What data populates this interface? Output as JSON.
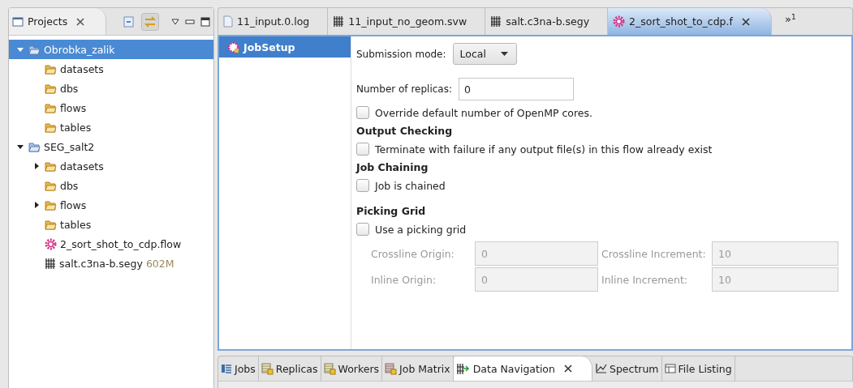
{
  "projects_view": {
    "title": "Projects",
    "tree": [
      {
        "label": "Obrobka_zalik",
        "kind": "project",
        "expanded": true,
        "selected": true,
        "children": [
          {
            "label": "datasets",
            "kind": "folder",
            "selected": false
          },
          {
            "label": "dbs",
            "kind": "folder",
            "selected": false
          },
          {
            "label": "flows",
            "kind": "folder",
            "selected": false
          },
          {
            "label": "tables",
            "kind": "folder",
            "selected": false
          }
        ]
      },
      {
        "label": "SEG_salt2",
        "kind": "project",
        "expanded": true,
        "selected": false,
        "children": [
          {
            "label": "datasets",
            "kind": "folder",
            "expanded": false,
            "selected": false
          },
          {
            "label": "dbs",
            "kind": "folder",
            "selected": false
          },
          {
            "label": "flows",
            "kind": "folder",
            "expanded": false,
            "selected": false
          },
          {
            "label": "tables",
            "kind": "folder",
            "selected": false
          },
          {
            "label": "2_sort_shot_to_cdp.flow",
            "kind": "flow",
            "selected": false
          },
          {
            "label": "salt.c3na-b.segy",
            "kind": "segy",
            "size": "602M",
            "selected": false
          }
        ]
      }
    ]
  },
  "editor_tabs": [
    {
      "label": "11_input.0.log",
      "kind": "log",
      "selected": false
    },
    {
      "label": "11_input_no_geom.svw",
      "kind": "segy",
      "selected": false
    },
    {
      "label": "salt.c3na-b.segy",
      "kind": "segy",
      "selected": false
    },
    {
      "label": "2_sort_shot_to_cdp.f",
      "kind": "flow",
      "selected": true
    }
  ],
  "overflow": {
    "glyph": "»",
    "count": "1"
  },
  "sections": [
    {
      "label": "JobSetup",
      "selected": true
    }
  ],
  "form_groups": [
    [
      {
        "kind": "select",
        "label": "Submission mode:",
        "value": "Local"
      }
    ],
    [
      {
        "kind": "text",
        "label": "Number of replicas:",
        "value": "0"
      },
      {
        "kind": "checkbox",
        "label": "Override default number of OpenMP cores.",
        "checked": false
      },
      {
        "kind": "heading",
        "label": "Output Checking"
      },
      {
        "kind": "checkbox",
        "label": "Terminate with failure if any output file(s) in this flow already exist",
        "checked": false
      },
      {
        "kind": "heading",
        "label": "Job Chaining"
      },
      {
        "kind": "checkbox",
        "label": "Job is chained",
        "checked": false
      }
    ],
    [
      {
        "kind": "heading",
        "label": "Picking Grid"
      },
      {
        "kind": "checkbox",
        "label": "Use a picking grid",
        "checked": false
      },
      {
        "kind": "grid",
        "fields": [
          {
            "label": "Crossline Origin:",
            "value": "0",
            "disabled": true
          },
          {
            "label": "Crossline Increment:",
            "value": "10",
            "disabled": true
          },
          {
            "label": "Inline Origin:",
            "value": "0",
            "disabled": true
          },
          {
            "label": "Inline Increment:",
            "value": "10",
            "disabled": true
          }
        ]
      }
    ]
  ],
  "bottom_tabs": [
    {
      "label": "Jobs",
      "kind": "jobs",
      "selected": false
    },
    {
      "label": "Replicas",
      "kind": "table",
      "selected": false
    },
    {
      "label": "Workers",
      "kind": "table",
      "selected": false
    },
    {
      "label": "Job Matrix",
      "kind": "matrix",
      "selected": false
    },
    {
      "label": "Data Navigation",
      "kind": "nav",
      "selected": true
    },
    {
      "label": "Spectrum",
      "kind": "chart",
      "selected": false
    },
    {
      "label": "File Listing",
      "kind": "list",
      "selected": false
    }
  ]
}
